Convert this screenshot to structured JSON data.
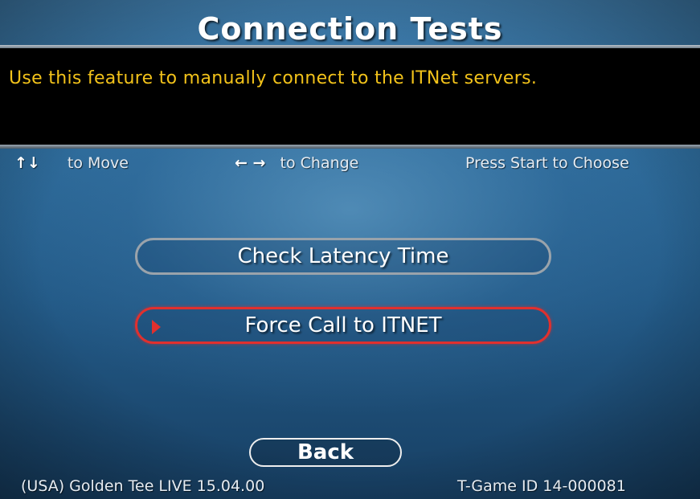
{
  "title": "Connection Tests",
  "description": "Use this feature to manually connect to the ITNet servers.",
  "help": {
    "move_icon": "up-down-arrows-icon",
    "move_arrows": "↑↓",
    "move_label": "to Move",
    "change_icon": "left-right-arrows-icon",
    "change_arrows": "← →",
    "change_label": "to Change",
    "choose_label": "Press Start to Choose"
  },
  "menu": [
    {
      "label": "Check Latency Time",
      "selected": false
    },
    {
      "label": "Force Call to ITNET",
      "selected": true
    }
  ],
  "back_label": "Back",
  "footer": {
    "version": "(USA) Golden Tee LIVE 15.04.00",
    "game_id": "T-Game ID 14-000081"
  },
  "colors": {
    "description_text": "#f2c21a",
    "selected_border": "#e0302e",
    "unselected_border": "#9aa3ab"
  }
}
